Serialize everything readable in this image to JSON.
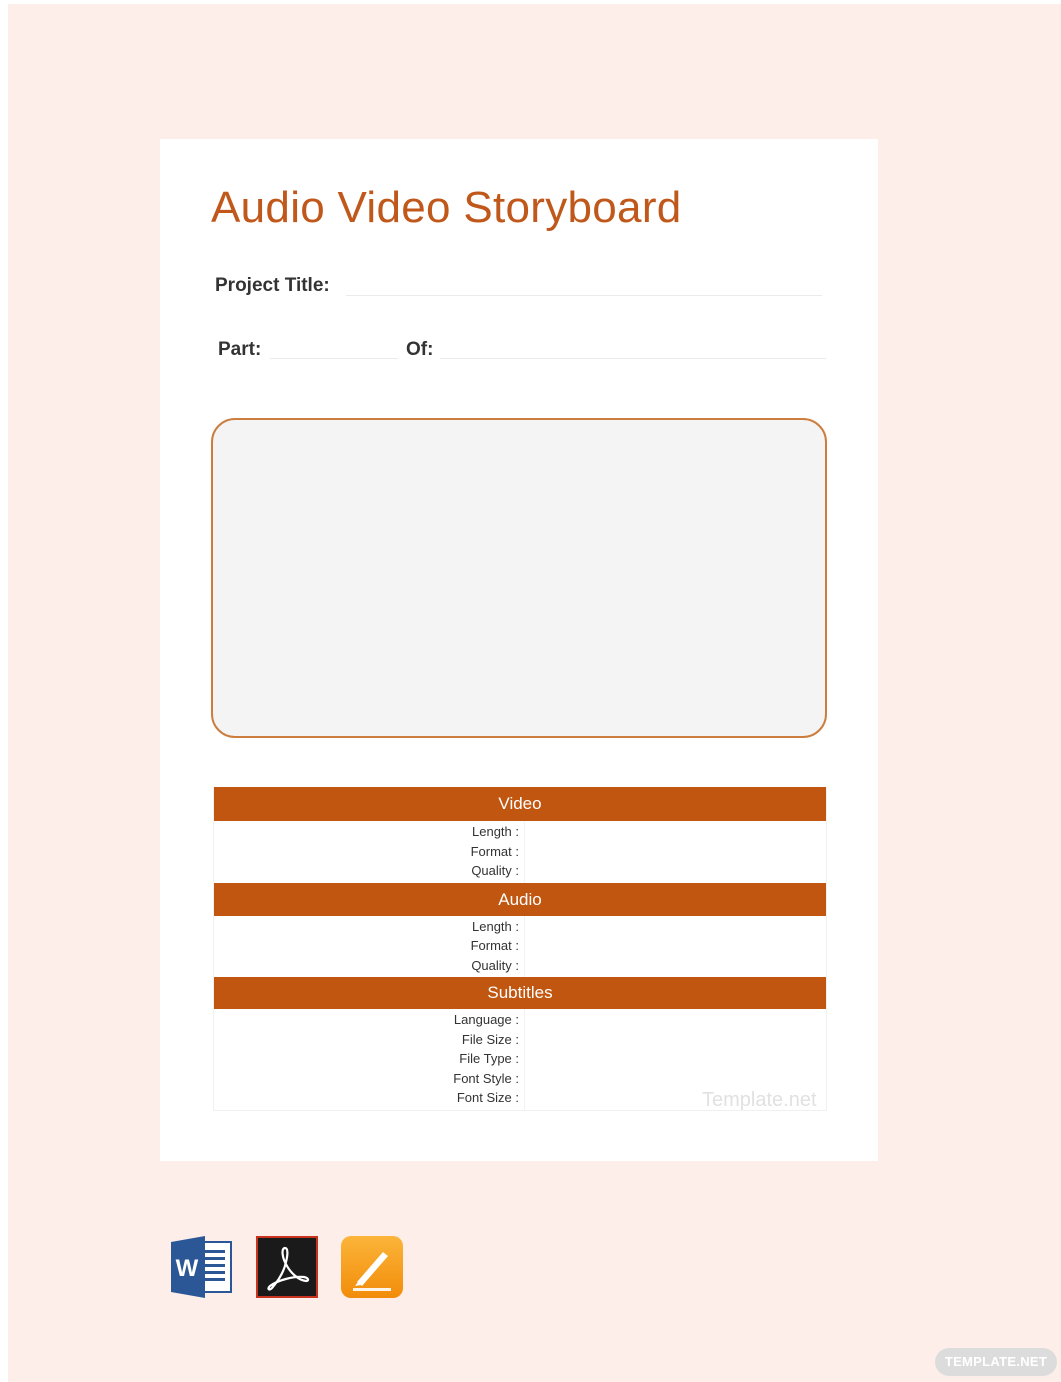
{
  "document": {
    "title": "Audio Video Storyboard",
    "fields": {
      "project_title_label": "Project Title:",
      "part_label": "Part:",
      "of_label": "Of:"
    },
    "sections": [
      {
        "title": "Video",
        "rows": [
          "Length :",
          "Format :",
          "Quality :"
        ]
      },
      {
        "title": "Audio",
        "rows": [
          "Length :",
          "Format :",
          "Quality :"
        ]
      },
      {
        "title": "Subtitles",
        "rows": [
          "Language :",
          "File Size :",
          "File Type :",
          "Font Style :",
          "Font Size :"
        ]
      }
    ],
    "watermark": "Template.net"
  },
  "formats": [
    {
      "name": "word-icon",
      "letter": "W",
      "color": "#2b5797"
    },
    {
      "name": "acrobat-pdf-icon",
      "color": "#1a1a1a"
    },
    {
      "name": "pages-icon",
      "color": "#f59a0e"
    }
  ],
  "badge": "TEMPLATE.NET",
  "colors": {
    "accent": "#c1581b",
    "background": "#fdeeea"
  }
}
